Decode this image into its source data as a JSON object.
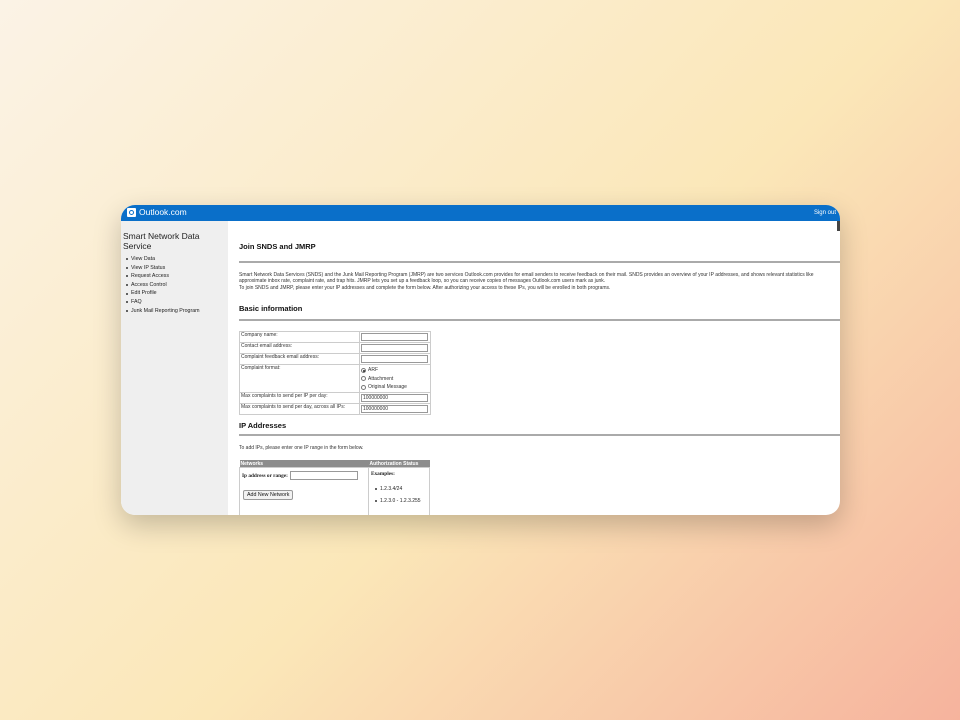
{
  "header": {
    "brand": "Outlook.com",
    "sign_out": "Sign out"
  },
  "sidebar": {
    "title": "Smart Network Data Service",
    "items": [
      {
        "label": "View Data"
      },
      {
        "label": "View IP Status"
      },
      {
        "label": "Request Access"
      },
      {
        "label": "Access Control"
      },
      {
        "label": "Edit Profile"
      },
      {
        "label": "FAQ"
      },
      {
        "label": "Junk Mail Reporting Program"
      }
    ]
  },
  "page": {
    "title": "Join SNDS and JMRP",
    "intro_1": "Smart Network Data Services (SNDS) and the Junk Mail Reporting Program (JMRP) are two services Outlook.com provides for email senders to receive feedback on their mail. SNDS provides an overview of your IP addresses, and shows relevant statistics like approximate inbox rate, complaint rate, and trap hits. JMRP lets you set up a feedback loop, so you can receive copies of messages Outlook.com users mark as junk.",
    "intro_2": "To join SNDS and JMRP, please enter your IP addresses and complete the form below. After authorizing your access to these IPs, you will be enrolled in both programs."
  },
  "basic": {
    "heading": "Basic information",
    "company_label": "Company name:",
    "contact_label": "Contact email address:",
    "feedback_label": "Complaint feedback email address:",
    "format_label": "Complaint format:",
    "format_options": [
      "ARF",
      "Attachment",
      "Original Message"
    ],
    "max_ip_label": "Max complaints to send per IP per day:",
    "max_ip_value": "100000000",
    "max_all_label": "Max complaints to send per day, across all IPs:",
    "max_all_value": "100000000"
  },
  "ip": {
    "heading": "IP Addresses",
    "instructions": "To add IPs, please enter one IP range in the form below.",
    "col_networks": "Networks",
    "col_status": "Authorization Status",
    "range_label": "Ip address or range:",
    "add_button": "Add New Network",
    "examples_label": "Examples:",
    "examples": [
      "1.2.3.4/24",
      "1.2.3.0 - 1.2.3.255"
    ]
  }
}
